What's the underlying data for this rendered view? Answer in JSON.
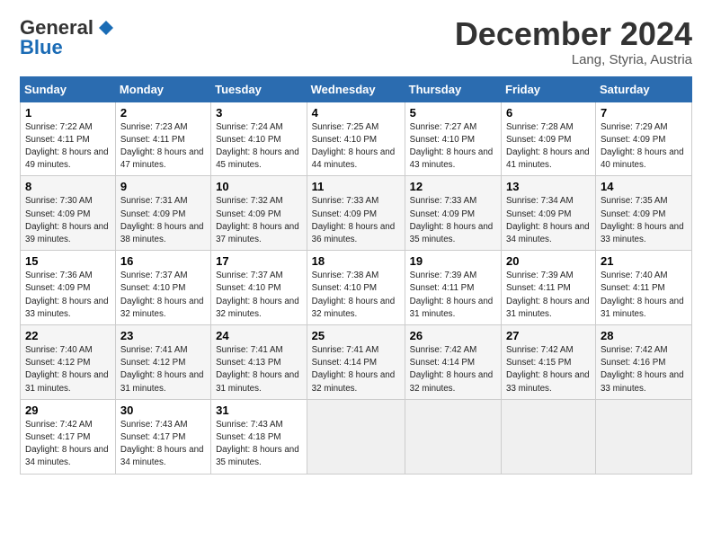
{
  "header": {
    "logo_general": "General",
    "logo_blue": "Blue",
    "month_title": "December 2024",
    "location": "Lang, Styria, Austria"
  },
  "calendar": {
    "days_of_week": [
      "Sunday",
      "Monday",
      "Tuesday",
      "Wednesday",
      "Thursday",
      "Friday",
      "Saturday"
    ],
    "weeks": [
      [
        null,
        {
          "num": "2",
          "sunrise": "7:23 AM",
          "sunset": "4:11 PM",
          "daylight": "8 hours and 47 minutes."
        },
        {
          "num": "3",
          "sunrise": "7:24 AM",
          "sunset": "4:10 PM",
          "daylight": "8 hours and 45 minutes."
        },
        {
          "num": "4",
          "sunrise": "7:25 AM",
          "sunset": "4:10 PM",
          "daylight": "8 hours and 44 minutes."
        },
        {
          "num": "5",
          "sunrise": "7:27 AM",
          "sunset": "4:10 PM",
          "daylight": "8 hours and 43 minutes."
        },
        {
          "num": "6",
          "sunrise": "7:28 AM",
          "sunset": "4:09 PM",
          "daylight": "8 hours and 41 minutes."
        },
        {
          "num": "7",
          "sunrise": "7:29 AM",
          "sunset": "4:09 PM",
          "daylight": "8 hours and 40 minutes."
        }
      ],
      [
        {
          "num": "1",
          "sunrise": "7:22 AM",
          "sunset": "4:11 PM",
          "daylight": "8 hours and 49 minutes."
        },
        {
          "num": "9",
          "sunrise": "7:31 AM",
          "sunset": "4:09 PM",
          "daylight": "8 hours and 38 minutes."
        },
        {
          "num": "10",
          "sunrise": "7:32 AM",
          "sunset": "4:09 PM",
          "daylight": "8 hours and 37 minutes."
        },
        {
          "num": "11",
          "sunrise": "7:33 AM",
          "sunset": "4:09 PM",
          "daylight": "8 hours and 36 minutes."
        },
        {
          "num": "12",
          "sunrise": "7:33 AM",
          "sunset": "4:09 PM",
          "daylight": "8 hours and 35 minutes."
        },
        {
          "num": "13",
          "sunrise": "7:34 AM",
          "sunset": "4:09 PM",
          "daylight": "8 hours and 34 minutes."
        },
        {
          "num": "14",
          "sunrise": "7:35 AM",
          "sunset": "4:09 PM",
          "daylight": "8 hours and 33 minutes."
        }
      ],
      [
        {
          "num": "8",
          "sunrise": "7:30 AM",
          "sunset": "4:09 PM",
          "daylight": "8 hours and 39 minutes."
        },
        {
          "num": "16",
          "sunrise": "7:37 AM",
          "sunset": "4:10 PM",
          "daylight": "8 hours and 32 minutes."
        },
        {
          "num": "17",
          "sunrise": "7:37 AM",
          "sunset": "4:10 PM",
          "daylight": "8 hours and 32 minutes."
        },
        {
          "num": "18",
          "sunrise": "7:38 AM",
          "sunset": "4:10 PM",
          "daylight": "8 hours and 32 minutes."
        },
        {
          "num": "19",
          "sunrise": "7:39 AM",
          "sunset": "4:11 PM",
          "daylight": "8 hours and 31 minutes."
        },
        {
          "num": "20",
          "sunrise": "7:39 AM",
          "sunset": "4:11 PM",
          "daylight": "8 hours and 31 minutes."
        },
        {
          "num": "21",
          "sunrise": "7:40 AM",
          "sunset": "4:11 PM",
          "daylight": "8 hours and 31 minutes."
        }
      ],
      [
        {
          "num": "15",
          "sunrise": "7:36 AM",
          "sunset": "4:09 PM",
          "daylight": "8 hours and 33 minutes."
        },
        {
          "num": "23",
          "sunrise": "7:41 AM",
          "sunset": "4:12 PM",
          "daylight": "8 hours and 31 minutes."
        },
        {
          "num": "24",
          "sunrise": "7:41 AM",
          "sunset": "4:13 PM",
          "daylight": "8 hours and 31 minutes."
        },
        {
          "num": "25",
          "sunrise": "7:41 AM",
          "sunset": "4:14 PM",
          "daylight": "8 hours and 32 minutes."
        },
        {
          "num": "26",
          "sunrise": "7:42 AM",
          "sunset": "4:14 PM",
          "daylight": "8 hours and 32 minutes."
        },
        {
          "num": "27",
          "sunrise": "7:42 AM",
          "sunset": "4:15 PM",
          "daylight": "8 hours and 33 minutes."
        },
        {
          "num": "28",
          "sunrise": "7:42 AM",
          "sunset": "4:16 PM",
          "daylight": "8 hours and 33 minutes."
        }
      ],
      [
        {
          "num": "22",
          "sunrise": "7:40 AM",
          "sunset": "4:12 PM",
          "daylight": "8 hours and 31 minutes."
        },
        {
          "num": "30",
          "sunrise": "7:43 AM",
          "sunset": "4:17 PM",
          "daylight": "8 hours and 34 minutes."
        },
        {
          "num": "31",
          "sunrise": "7:43 AM",
          "sunset": "4:18 PM",
          "daylight": "8 hours and 35 minutes."
        },
        null,
        null,
        null,
        null
      ],
      [
        {
          "num": "29",
          "sunrise": "7:42 AM",
          "sunset": "4:17 PM",
          "daylight": "8 hours and 34 minutes."
        },
        null,
        null,
        null,
        null,
        null,
        null
      ]
    ],
    "labels": {
      "sunrise": "Sunrise:",
      "sunset": "Sunset:",
      "daylight": "Daylight:"
    }
  }
}
